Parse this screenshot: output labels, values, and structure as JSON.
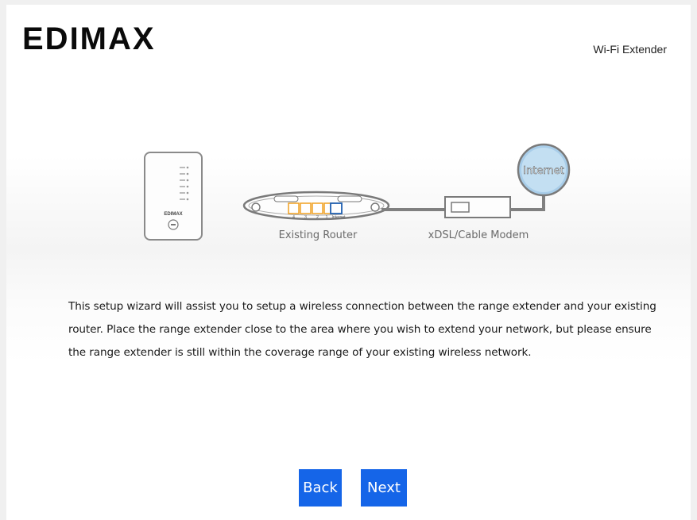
{
  "header": {
    "brand": "EDIMAX",
    "product": "Wi-Fi Extender"
  },
  "diagram": {
    "extender_brand": "EDIMAX",
    "router_label": "Existing Router",
    "router_port_numbers": [
      "4",
      "3",
      "2",
      "1"
    ],
    "router_internet_port": "Internet",
    "modem_label": "xDSL/Cable Modem",
    "cloud_label": "Internet"
  },
  "main": {
    "description": "This setup wizard will assist you to setup a wireless connection between the range extender and your existing router. Place the range extender close to the area where you wish to extend your network, but please ensure the range extender is still within the coverage range of your existing wireless network."
  },
  "footer": {
    "back_label": "Back",
    "next_label": "Next"
  },
  "colors": {
    "button": "#1565e8",
    "router_ports": "#f0a020",
    "internet_port": "#1f5fb0",
    "globe": "#a8cde9"
  }
}
